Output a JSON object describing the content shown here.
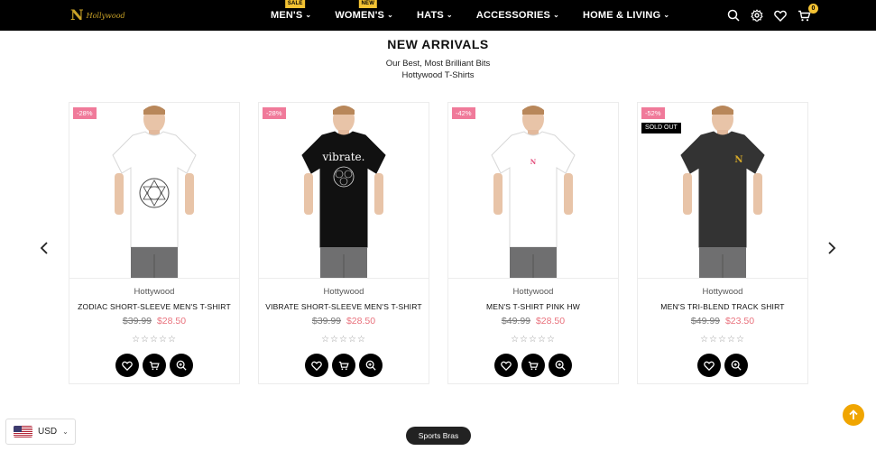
{
  "brand": {
    "logo_text": "Hollywood"
  },
  "nav": {
    "items": [
      {
        "label": "MEN'S",
        "badge": "SALE"
      },
      {
        "label": "WOMEN'S",
        "badge": "NEW"
      },
      {
        "label": "HATS",
        "badge": ""
      },
      {
        "label": "ACCESSORIES",
        "badge": ""
      },
      {
        "label": "HOME & LIVING",
        "badge": ""
      }
    ]
  },
  "header_icons": [
    "search-icon",
    "gear-icon",
    "heart-icon",
    "cart-icon"
  ],
  "cart": {
    "count": "0"
  },
  "section": {
    "title": "NEW ARRIVALS",
    "subtitle_line1": "Our Best, Most Brilliant Bits",
    "subtitle_line2": "Hottywood T-Shirts"
  },
  "products": [
    {
      "discount": "-28%",
      "sold_out": "",
      "brand": "Hottywood",
      "name": "ZODIAC SHORT-SLEEVE MEN'S T-SHIRT",
      "old_price": "$39.99",
      "price": "$28.50",
      "shirt_color": "#ffffff",
      "rating_stars": "☆☆☆☆☆"
    },
    {
      "discount": "-28%",
      "sold_out": "",
      "brand": "Hottywood",
      "name": "VIBRATE SHORT-SLEEVE MEN'S T-SHIRT",
      "old_price": "$39.99",
      "price": "$28.50",
      "shirt_color": "#111111",
      "print_text": "vibrate.",
      "rating_stars": "☆☆☆☆☆"
    },
    {
      "discount": "-42%",
      "sold_out": "",
      "brand": "Hottywood",
      "name": "MEN'S T-SHIRT PINK HW",
      "old_price": "$49.99",
      "price": "$28.50",
      "shirt_color": "#ffffff",
      "print_text": "N",
      "rating_stars": "☆☆☆☆☆"
    },
    {
      "discount": "-52%",
      "sold_out": "SOLD OUT",
      "brand": "Hottywood",
      "name": "MEN'S TRI-BLEND TRACK SHIRT",
      "old_price": "$49.99",
      "price": "$23.50",
      "shirt_color": "#333333",
      "print_text": "N",
      "rating_stars": "☆☆☆☆☆"
    }
  ],
  "currency": {
    "code": "USD"
  },
  "bottom_pill": {
    "label": "Sports Bras"
  },
  "colors": {
    "accent": "#f3c233",
    "sale_price": "#e9727d",
    "discount_badge": "#f07a9a",
    "scroll_top": "#f0a500"
  }
}
